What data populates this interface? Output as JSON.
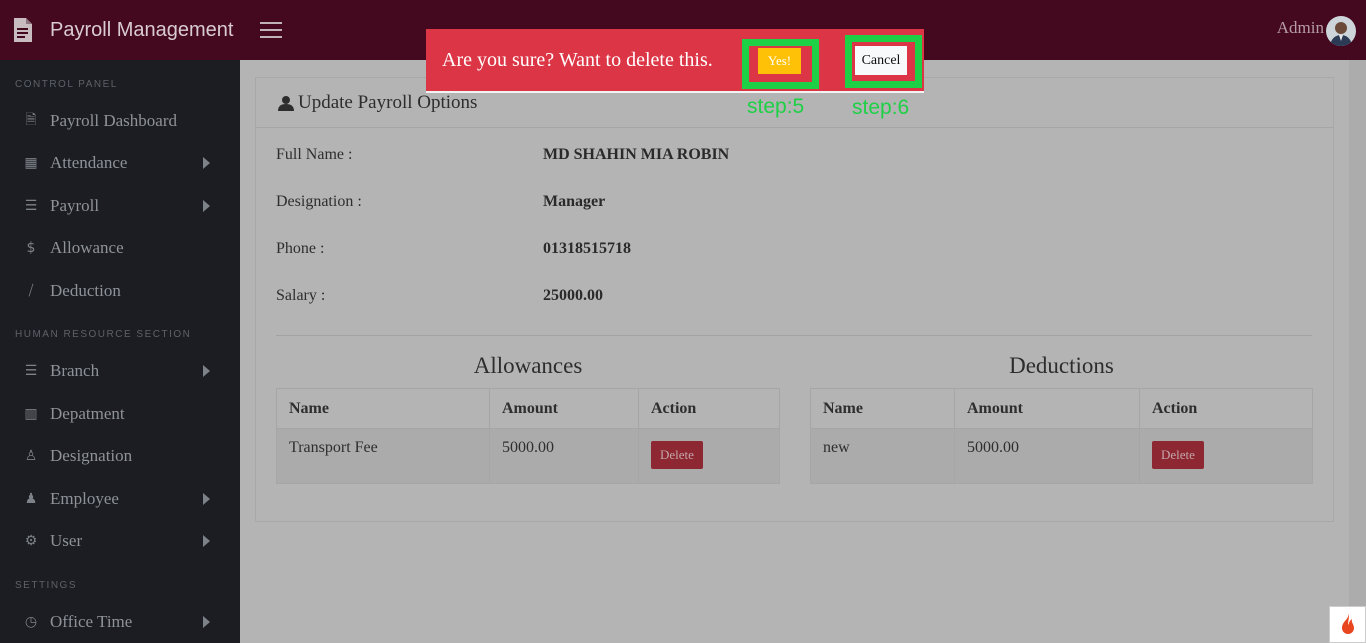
{
  "header": {
    "app_title": "Payroll Management",
    "user_name": "Admin"
  },
  "sidebar": {
    "sections": [
      {
        "label": "CONTROL PANEL"
      },
      {
        "label": "HUMAN RESOURCE SECTION"
      },
      {
        "label": "SETTINGS"
      }
    ],
    "items": [
      {
        "label": "Payroll Dashboard",
        "icon": "document-icon"
      },
      {
        "label": "Attendance",
        "icon": "calendar-icon"
      },
      {
        "label": "Payroll",
        "icon": "list-check-icon"
      },
      {
        "label": "Allowance",
        "icon": "dollar-icon"
      },
      {
        "label": "Deduction",
        "icon": "dollar-slash-icon"
      },
      {
        "label": "Branch",
        "icon": "list-check-icon"
      },
      {
        "label": "Depatment",
        "icon": "columns-icon"
      },
      {
        "label": "Designation",
        "icon": "user-icon"
      },
      {
        "label": "Employee",
        "icon": "user-tie-icon"
      },
      {
        "label": "User",
        "icon": "user-gear-icon"
      },
      {
        "label": "Office Time",
        "icon": "user-clock-icon"
      }
    ]
  },
  "card": {
    "title": "Update Payroll Options",
    "fields": [
      {
        "label": "Full Name :",
        "value": "MD SHAHIN MIA ROBIN"
      },
      {
        "label": "Designation :",
        "value": "Manager"
      },
      {
        "label": "Phone :",
        "value": "01318515718"
      },
      {
        "label": "Salary :",
        "value": "25000.00"
      }
    ]
  },
  "allowances": {
    "title": "Allowances",
    "headers": [
      "Name",
      "Amount",
      "Action"
    ],
    "rows": [
      {
        "name": "Transport Fee",
        "amount": "5000.00",
        "action": "Delete"
      }
    ]
  },
  "deductions": {
    "title": "Deductions",
    "headers": [
      "Name",
      "Amount",
      "Action"
    ],
    "rows": [
      {
        "name": "new",
        "amount": "5000.00",
        "action": "Delete"
      }
    ]
  },
  "dialog": {
    "message": "Are you sure? Want to delete this.",
    "confirm_label": "Yes!",
    "cancel_label": "Cancel"
  },
  "annotations": {
    "step5": "step:5",
    "step6": "step:6"
  },
  "colors": {
    "topbar": "#45091f",
    "sidebar": "#1b1d22",
    "dialog": "#dc3545",
    "confirm": "#ffc107",
    "highlight": "#1ed045",
    "delete_button": "#8d2731"
  }
}
